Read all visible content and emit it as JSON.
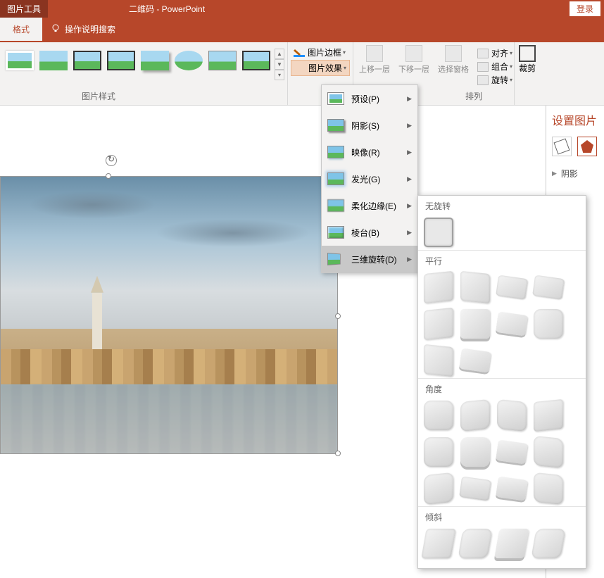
{
  "topbar": {
    "context_tool": "图片工具",
    "doc_title": "二维码  -  PowerPoint",
    "login": "登录"
  },
  "tabs": {
    "format": "格式",
    "help_search": "操作说明搜索"
  },
  "ribbon": {
    "styles_label": "图片样式",
    "pic_border": "图片边框",
    "pic_effect": "图片效果",
    "arrange": {
      "bring_fwd": "上移一层",
      "send_back": "下移一层",
      "selection_pane": "选择窗格",
      "align": "对齐",
      "group": "组合",
      "rotate": "旋转",
      "label": "排列"
    },
    "crop": "裁剪"
  },
  "effects_menu": {
    "preset": "预设(P)",
    "shadow": "阴影(S)",
    "reflection": "映像(R)",
    "glow": "发光(G)",
    "soft_edge": "柔化边缘(E)",
    "bevel": "棱台(B)",
    "rotation3d": "三维旋转(D)"
  },
  "rot3d": {
    "no_rotation": "无旋转",
    "parallel": "平行",
    "perspective": "角度",
    "oblique": "倾斜"
  },
  "format_pane": {
    "title": "设置图片",
    "shadow_section": "阴影"
  }
}
